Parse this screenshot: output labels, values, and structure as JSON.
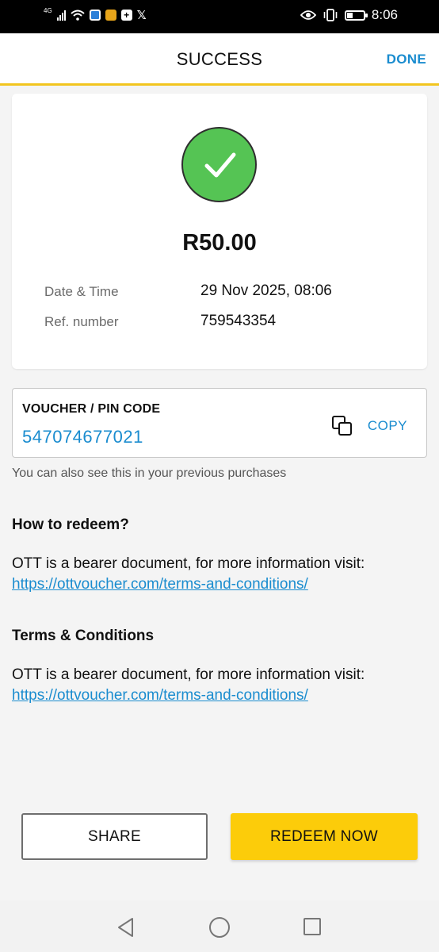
{
  "status_bar": {
    "network": "4G",
    "time": "8:06",
    "icons": [
      "signal-icon",
      "wifi-icon",
      "shield-app-icon",
      "stack-app-icon",
      "plus-app-icon",
      "x-icon",
      "eye-icon",
      "vibrate-icon",
      "battery-icon"
    ]
  },
  "header": {
    "title": "SUCCESS",
    "done_label": "DONE",
    "accent_color": "#f2c51f"
  },
  "receipt": {
    "amount": "R50.00",
    "date_label": "Date & Time",
    "date_value": "29 Nov 2025, 08:06",
    "ref_label": "Ref. number",
    "ref_value": "759543354",
    "success_color": "#55c454"
  },
  "voucher": {
    "label": "VOUCHER / PIN CODE",
    "code": "547074677021",
    "copy_label": "COPY",
    "hint": "You can also see this in your previous purchases"
  },
  "redeem": {
    "heading": "How to redeem?",
    "text": "OTT is a bearer document, for more information visit:",
    "link": "https://ottvoucher.com/terms-and-conditions/"
  },
  "terms": {
    "heading": "Terms & Conditions",
    "text": "OTT is a bearer document, for more information visit:",
    "link": "https://ottvoucher.com/terms-and-conditions/"
  },
  "actions": {
    "share_label": "SHARE",
    "redeem_label": "REDEEM NOW",
    "redeem_color": "#fccc0a"
  }
}
